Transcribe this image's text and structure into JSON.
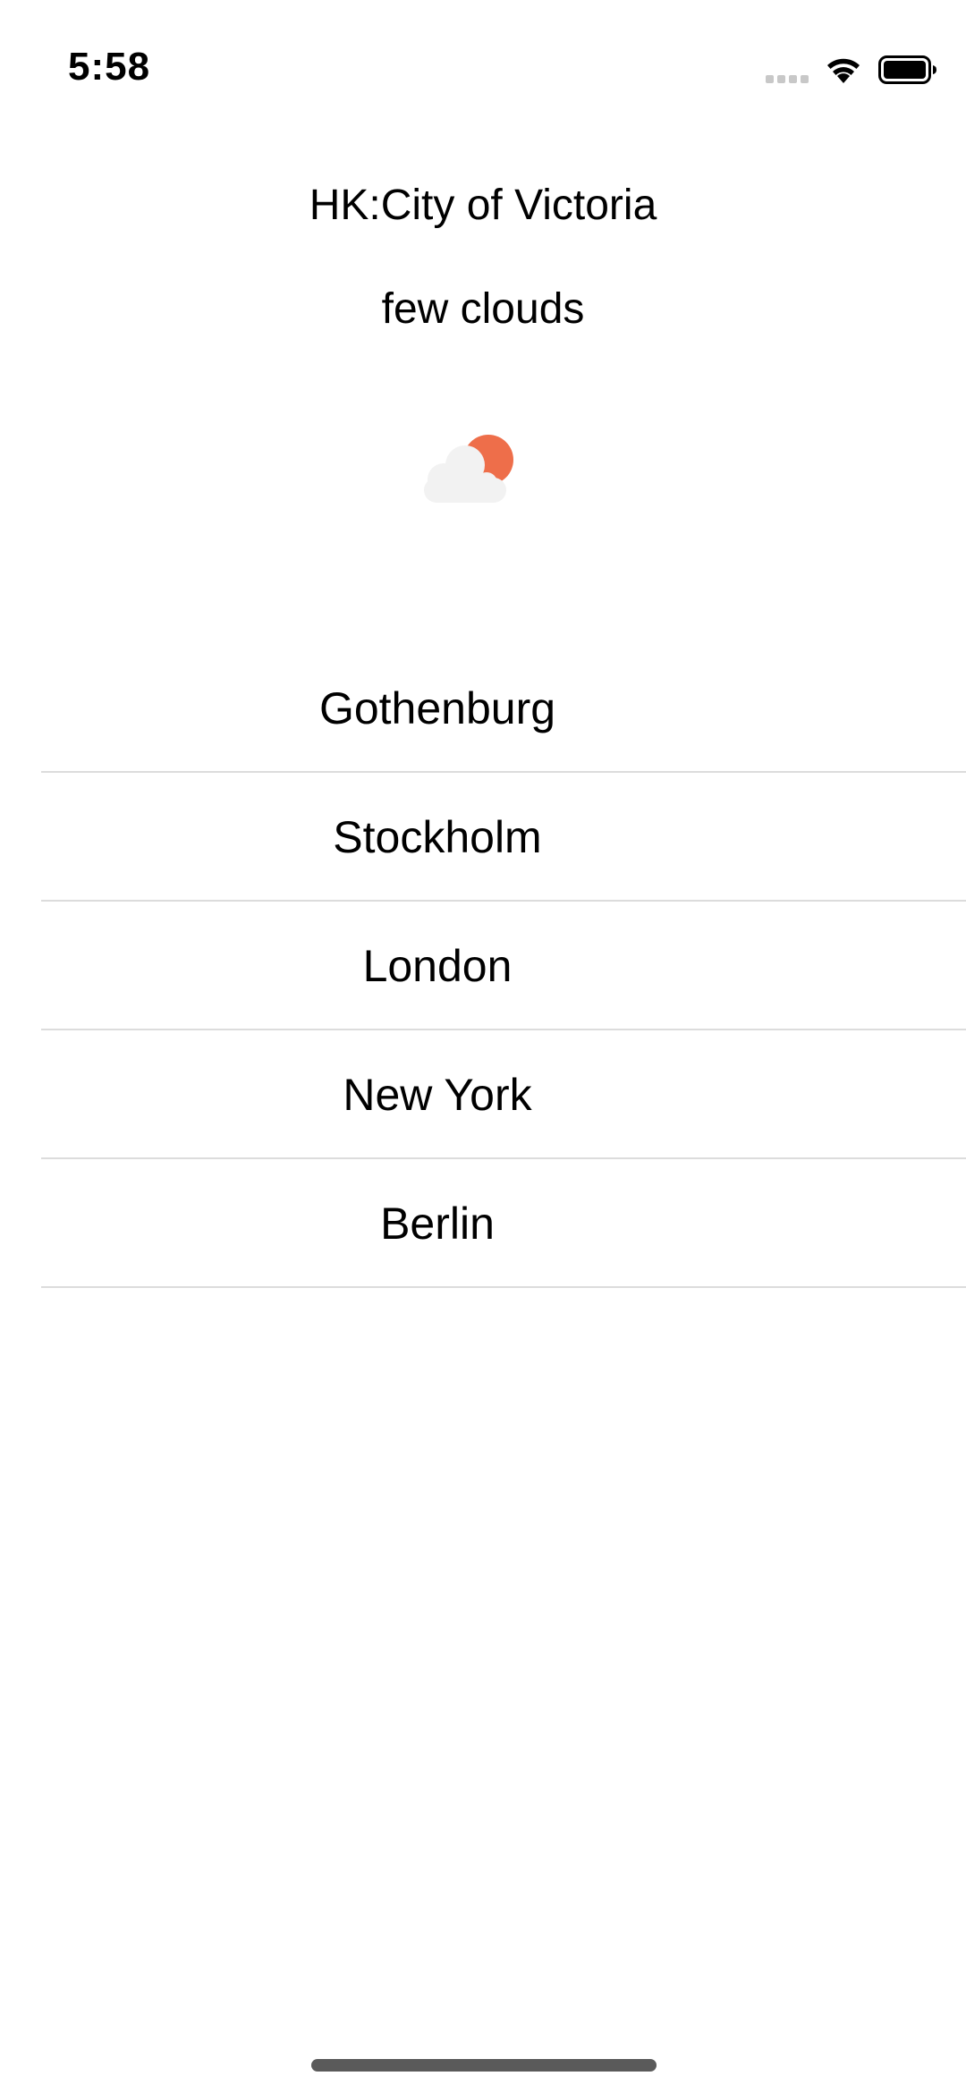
{
  "status_bar": {
    "time": "5:58",
    "icons": [
      "cellular-signal-icon",
      "wifi-icon",
      "battery-icon"
    ]
  },
  "header": {
    "location": "HK:City of Victoria",
    "description": "few clouds",
    "weather_icon": "few-clouds-icon"
  },
  "cities": [
    {
      "label": "Gothenburg"
    },
    {
      "label": "Stockholm"
    },
    {
      "label": "London"
    },
    {
      "label": "New York"
    },
    {
      "label": "Berlin"
    }
  ],
  "colors": {
    "sun": "#ee6e4a",
    "cloud": "#f2f2f2",
    "separator": "#dcdcdc",
    "text": "#000000",
    "background": "#ffffff"
  }
}
